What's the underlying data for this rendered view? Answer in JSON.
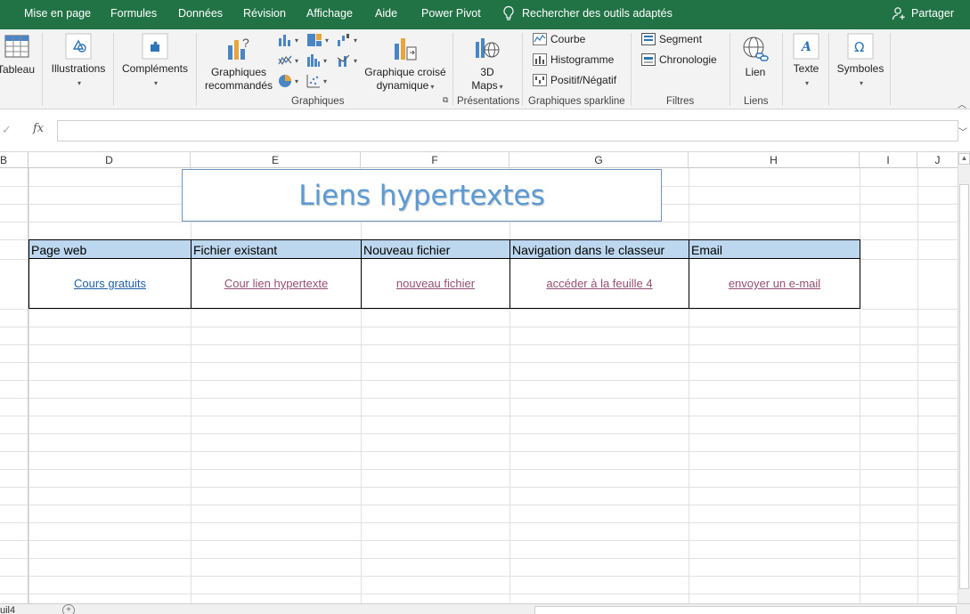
{
  "tabs": [
    "Mise en page",
    "Formules",
    "Données",
    "Révision",
    "Affichage",
    "Aide",
    "Power Pivot"
  ],
  "tell_me": "Rechercher des outils adaptés",
  "share": "Partager",
  "ribbon": {
    "tableau": "Tableau",
    "illustrations": "Illustrations",
    "complements": "Compléments",
    "graphiques_recommandes_1": "Graphiques",
    "graphiques_recommandes_2": "recommandés",
    "graphique_croise_1": "Graphique croisé",
    "graphique_croise_2": "dynamique",
    "maps_1": "3D",
    "maps_2": "Maps",
    "courbe": "Courbe",
    "histogramme": "Histogramme",
    "positif_negatif": "Positif/Négatif",
    "segment": "Segment",
    "chronologie": "Chronologie",
    "lien": "Lien",
    "texte": "Texte",
    "symboles": "Symboles",
    "groups": {
      "graphiques": "Graphiques",
      "presentations": "Présentations",
      "sparkline": "Graphiques sparkline",
      "filtres": "Filtres",
      "liens": "Liens"
    }
  },
  "formula_bar": {
    "fx": "fx",
    "value": ""
  },
  "columns": [
    "B",
    "D",
    "E",
    "F",
    "G",
    "H",
    "I",
    "J"
  ],
  "sheet": {
    "title": "Liens hypertextes",
    "headers": [
      "Page web",
      "Fichier existant",
      "Nouveau fichier",
      "Navigation dans le classeur",
      "Email"
    ],
    "links": [
      "Cours gratuits",
      "Cour lien hypertexte ",
      "nouveau fichier",
      "accéder à la feuille 4 ",
      "envoyer un e-mail "
    ]
  },
  "sheet_tab": "uil4"
}
